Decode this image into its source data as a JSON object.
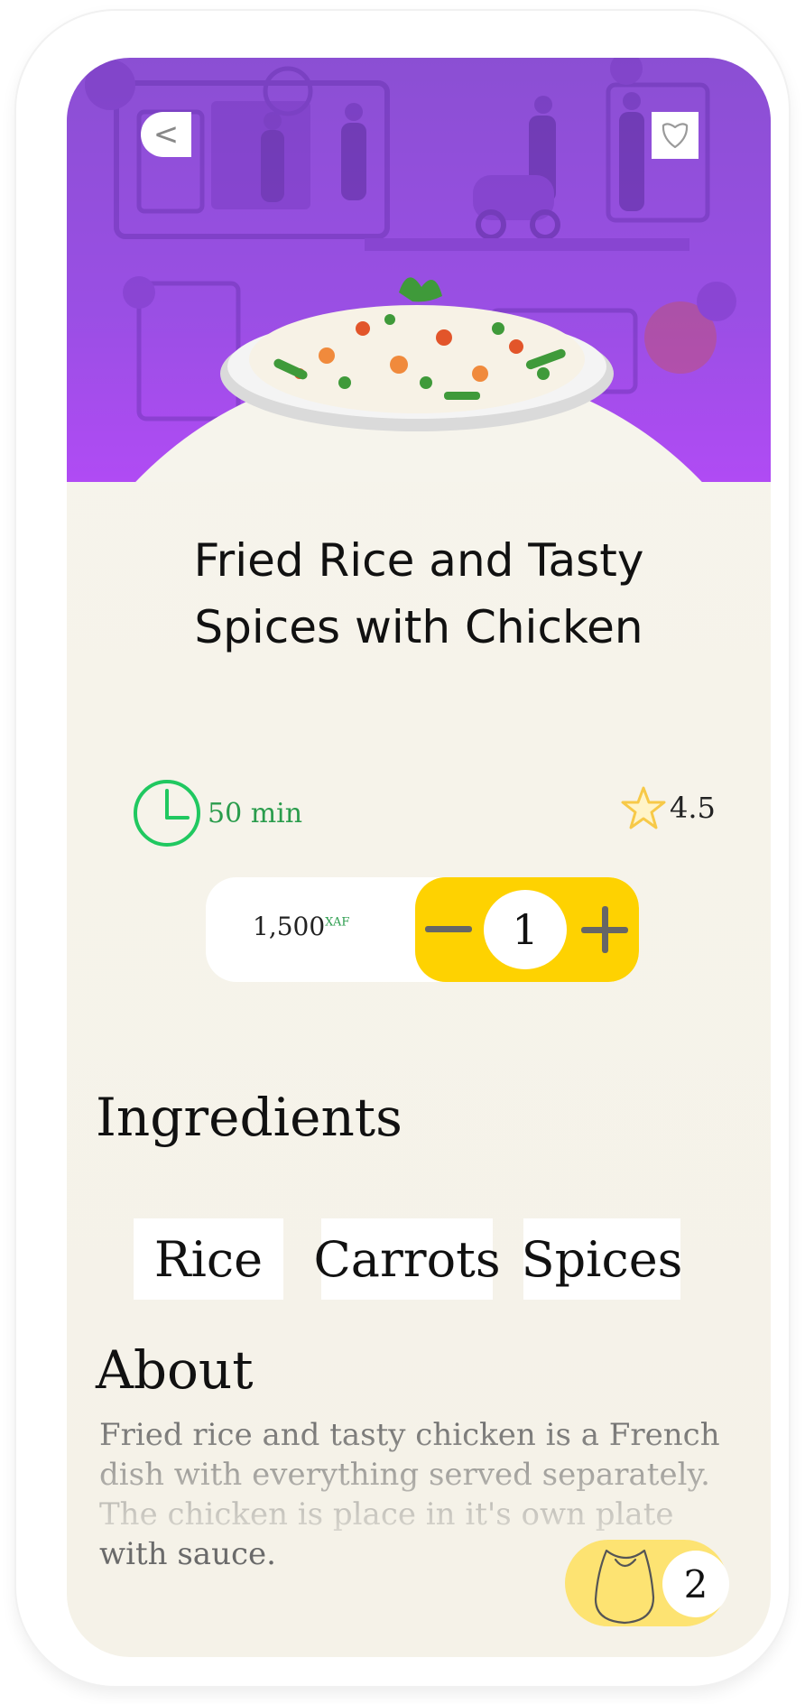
{
  "dish": {
    "title_line1": "Fried Rice and Tasty",
    "title_line2": "Spices with Chicken"
  },
  "info": {
    "time": "50 min",
    "rating": "4.5"
  },
  "order": {
    "price": "1,500",
    "currency": "XAF",
    "quantity": "1"
  },
  "ingredients": {
    "heading": "Ingredients",
    "items": [
      "Rice",
      "Carrots",
      "Spices"
    ]
  },
  "about": {
    "heading": "About",
    "text": "Fried rice and tasty chicken is a French dish with everything served separately. The chicken is place in it's own plate with sauce."
  },
  "cart": {
    "count": "2"
  },
  "icons": {
    "back": "chevron-left-icon",
    "favorite": "heart-icon",
    "time": "clock-icon",
    "rating": "star-icon",
    "decrement": "minus-icon",
    "increment": "plus-icon",
    "cart": "shopping-bag-icon"
  },
  "colors": {
    "hero_purple": "#9a4fe4",
    "accent_yellow": "#fed201",
    "time_green": "#2a9c4c",
    "star_yellow": "#f7c948",
    "background_cream": "#f6f4ec"
  }
}
